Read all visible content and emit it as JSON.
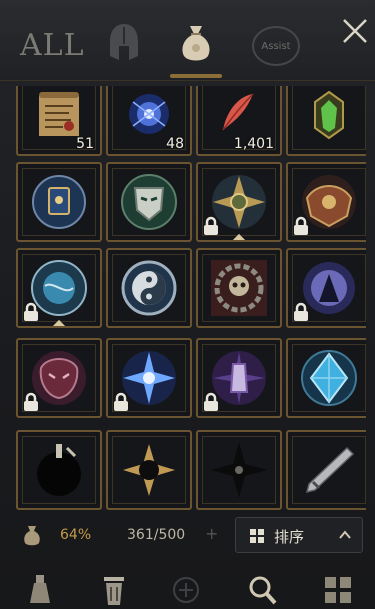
{
  "header": {
    "tab_all_label": "ALL",
    "tab_assist_label": "Assist"
  },
  "items": [
    {
      "name": "scroll",
      "quantity": "51"
    },
    {
      "name": "soul-orb",
      "quantity": "48"
    },
    {
      "name": "red-feather",
      "quantity": "1,401"
    },
    {
      "name": "green-crystal-charm",
      "quantity": ""
    },
    {
      "name": "blue-tome-relic",
      "quantity": ""
    },
    {
      "name": "green-mask-relic",
      "quantity": ""
    },
    {
      "name": "golden-sigil-relic",
      "quantity": ""
    },
    {
      "name": "bronze-emblem-relic",
      "quantity": ""
    },
    {
      "name": "blue-globe-relic",
      "quantity": ""
    },
    {
      "name": "yin-yang-relic",
      "quantity": ""
    },
    {
      "name": "skull-wreath-relic",
      "quantity": ""
    },
    {
      "name": "dark-orb-relic",
      "quantity": ""
    },
    {
      "name": "crimson-beast-relic",
      "quantity": ""
    },
    {
      "name": "blue-star-relic",
      "quantity": ""
    },
    {
      "name": "purple-idol-relic",
      "quantity": ""
    },
    {
      "name": "blue-diamond-relic",
      "quantity": ""
    },
    {
      "name": "black-flask",
      "quantity": ""
    },
    {
      "name": "dark-compass",
      "quantity": ""
    },
    {
      "name": "shadow-sigil",
      "quantity": ""
    },
    {
      "name": "silver-blade",
      "quantity": ""
    }
  ],
  "footer": {
    "weight_percent": "64%",
    "capacity": "361/500",
    "sort_label": "排序"
  },
  "colors": {
    "frame_gold": "#6b5530",
    "accent": "#c39a49"
  }
}
